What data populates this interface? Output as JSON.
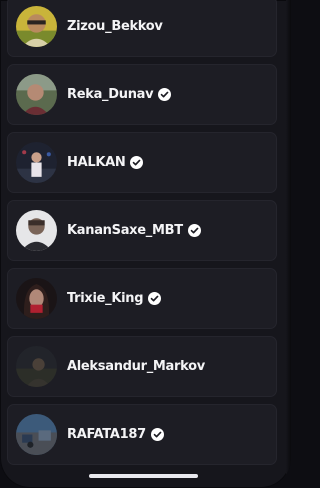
{
  "colors": {
    "background": "#16161c",
    "card": "#1d1d24",
    "text": "#f4f4f6",
    "verified_badge": "#ffffff"
  },
  "users": [
    {
      "name": "Zizou_Bekkov",
      "verified": false,
      "avatar_icon": "user-photo-avatar"
    },
    {
      "name": "Reka_Dunav",
      "verified": true,
      "avatar_icon": "user-photo-avatar"
    },
    {
      "name": "HALKAN",
      "verified": true,
      "avatar_icon": "user-photo-avatar"
    },
    {
      "name": "KananSaxe_MBT",
      "verified": true,
      "avatar_icon": "user-photo-avatar"
    },
    {
      "name": "Trixie_King",
      "verified": true,
      "avatar_icon": "user-photo-avatar"
    },
    {
      "name": "Aleksandur_Markov",
      "verified": false,
      "avatar_icon": "user-photo-avatar"
    },
    {
      "name": "RAFATA187",
      "verified": true,
      "avatar_icon": "user-photo-avatar"
    }
  ]
}
